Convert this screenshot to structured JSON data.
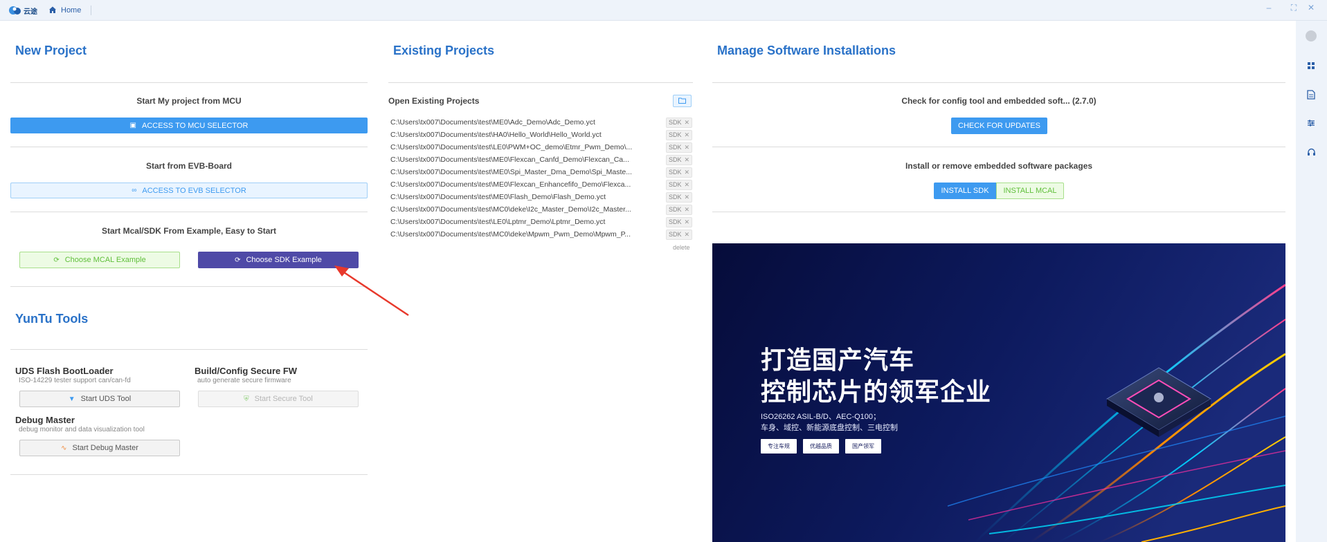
{
  "titlebar": {
    "logo_text": "云途",
    "home_label": "Home",
    "minimize": "–",
    "maximize": "⛶",
    "close": "✕"
  },
  "new_project": {
    "title": "New Project",
    "mcu_heading": "Start My project from MCU",
    "mcu_button": "ACCESS TO MCU SELECTOR",
    "evb_heading": "Start from EVB-Board",
    "evb_button": "ACCESS TO EVB SELECTOR",
    "example_heading": "Start Mcal/SDK From Example, Easy to Start",
    "mcal_example_button": "Choose MCAL Example",
    "sdk_example_button": "Choose SDK Example"
  },
  "yuntu_tools": {
    "title": "YunTu Tools",
    "tools": [
      {
        "name": "UDS Flash BootLoader",
        "desc": "ISO-14229 tester support can/can-fd",
        "button": "Start UDS Tool"
      },
      {
        "name": "Build/Config Secure FW",
        "desc": "auto generate secure firmware",
        "button": "Start Secure Tool"
      },
      {
        "name": "Debug Master",
        "desc": "debug monitor and data visualization tool",
        "button": "Start Debug Master"
      }
    ]
  },
  "existing_projects": {
    "title": "Existing Projects",
    "open_label": "Open Existing Projects",
    "tag": "SDK",
    "delete_label": "delete",
    "projects": [
      "C:\\Users\\tx007\\Documents\\test\\ME0\\Adc_Demo\\Adc_Demo.yct",
      "C:\\Users\\tx007\\Documents\\test\\HA0\\Hello_World\\Hello_World.yct",
      "C:\\Users\\tx007\\Documents\\test\\LE0\\PWM+OC_demo\\Etmr_Pwm_Demo\\...",
      "C:\\Users\\tx007\\Documents\\test\\ME0\\Flexcan_Canfd_Demo\\Flexcan_Ca...",
      "C:\\Users\\tx007\\Documents\\test\\ME0\\Spi_Master_Dma_Demo\\Spi_Maste...",
      "C:\\Users\\tx007\\Documents\\test\\ME0\\Flexcan_Enhancefifo_Demo\\Flexca...",
      "C:\\Users\\tx007\\Documents\\test\\ME0\\Flash_Demo\\Flash_Demo.yct",
      "C:\\Users\\tx007\\Documents\\test\\MC0\\deke\\I2c_Master_Demo\\I2c_Master...",
      "C:\\Users\\tx007\\Documents\\test\\LE0\\Lptmr_Demo\\Lptmr_Demo.yct",
      "C:\\Users\\tx007\\Documents\\test\\MC0\\deke\\Mpwm_Pwm_Demo\\Mpwm_P..."
    ]
  },
  "software": {
    "title": "Manage Software Installations",
    "check_heading": "Check for config tool and embedded soft... (2.7.0)",
    "check_button": "CHECK FOR UPDATES",
    "install_heading": "Install or remove embedded software packages",
    "install_sdk": "INSTALL SDK",
    "install_mcal": "INSTALL MCAL"
  },
  "banner": {
    "line1": "打造国产汽车",
    "line2": "控制芯片的领军企业",
    "sub1": "ISO26262 ASIL-B/D、AEC-Q100；",
    "sub2": "车身、域控、新能源底盘控制、三电控制",
    "chips": [
      "专注车规",
      "优越品质",
      "国产领军"
    ]
  },
  "colors": {
    "accent": "#2a72c8",
    "primary_button": "#3d9af0",
    "sdk_button": "#4f4aa7",
    "mcal_green": "#5fbf3a",
    "arrow_red": "#e8392c"
  }
}
